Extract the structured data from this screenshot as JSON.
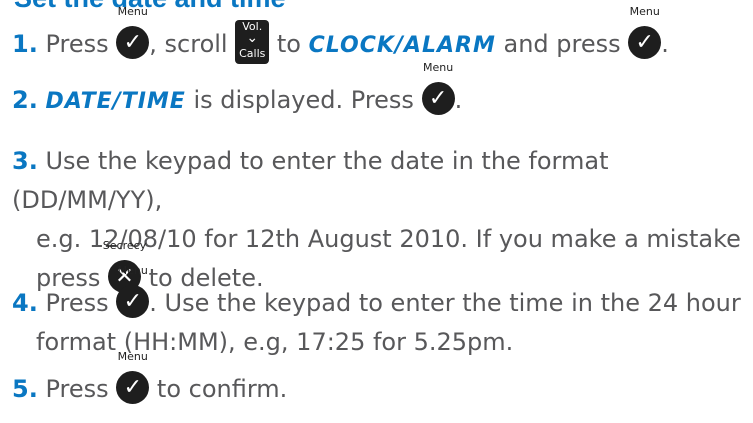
{
  "heading": "Set the date and time",
  "keys": {
    "menu_caption": "Menu",
    "secrecy_caption": "Secrecy",
    "vol_top": "Vol.",
    "vol_bottom": "Calls"
  },
  "steps": [
    {
      "number": "1.",
      "t1": "Press",
      "t2": ", scroll",
      "t3": "to",
      "display": "CLOCK/ALARM",
      "t4": "and press",
      "t5": "."
    },
    {
      "number": "2.",
      "display": "DATE/TIME",
      "t1": "is displayed. Press",
      "t2": "."
    },
    {
      "number": "3.",
      "line1": "Use the keypad to enter the date in the format (DD/MM/YY),",
      "line2": "e.g. 12/08/10 for 12th August 2010. If you make a mistake",
      "line3a": "press",
      "line3b": "to delete."
    },
    {
      "number": "4.",
      "t1": "Press",
      "t2": ". Use the keypad to enter the time in the 24 hour",
      "line2": "format (HH:MM), e.g, 17:25 for 5.25pm."
    },
    {
      "number": "5.",
      "t1": "Press",
      "t2": "to confirm."
    }
  ]
}
